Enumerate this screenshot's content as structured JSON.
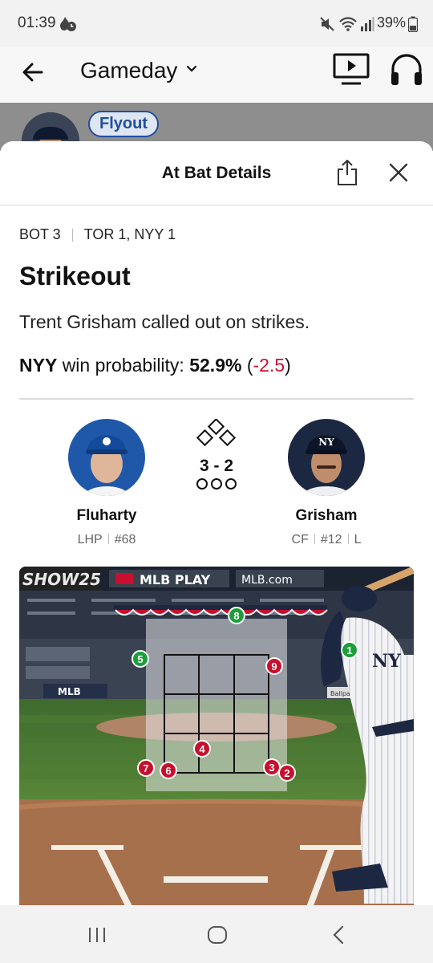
{
  "status_bar": {
    "time": "01:39",
    "battery": "39%"
  },
  "app_bar": {
    "title": "Gameday"
  },
  "background": {
    "previous_result": "Flyout"
  },
  "sheet": {
    "title": "At Bat Details",
    "inning": "BOT 3",
    "score": "TOR 1, NYY 1",
    "result": "Strikeout",
    "description": "Trent Grisham called out on strikes.",
    "win_probability": {
      "team": "NYY",
      "label": "win probability:",
      "value": "52.9%",
      "paren_open": " (",
      "delta": "-2.5",
      "paren_close": ")"
    },
    "pitcher": {
      "name": "Fluharty",
      "position": "LHP",
      "number": "#68"
    },
    "batter": {
      "name": "Grisham",
      "position": "CF",
      "number": "#12",
      "bats": "L"
    },
    "count": "3 - 2",
    "outs": 0,
    "pitches": [
      {
        "number": "1",
        "result": "strike"
      },
      {
        "number": "2",
        "result": "ball"
      },
      {
        "number": "3",
        "result": "ball"
      },
      {
        "number": "4",
        "result": "ball"
      },
      {
        "number": "5",
        "result": "strike"
      },
      {
        "number": "6",
        "result": "ball"
      },
      {
        "number": "7",
        "result": "ball"
      },
      {
        "number": "8",
        "result": "strike"
      },
      {
        "number": "9",
        "result": "ball"
      }
    ],
    "ads": {
      "board_left": "SHOW25",
      "board_mid": "MLB PLAY",
      "board_right": "MLB.com"
    }
  },
  "colors": {
    "strike": "#1e9e3a",
    "ball": "#c8102e",
    "accent": "#1f4e9d",
    "yankees_navy": "#1c2841",
    "blue_jays": "#134a9c"
  }
}
